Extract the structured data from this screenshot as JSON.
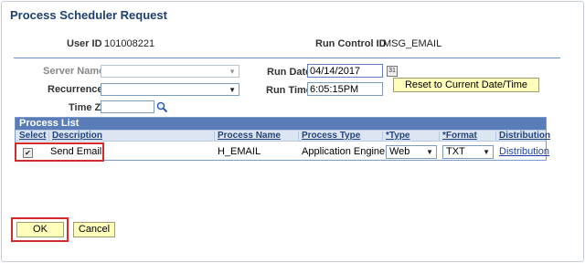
{
  "page": {
    "title": "Process Scheduler Request"
  },
  "header": {
    "user_id_label": "User ID",
    "user_id_value": "101008221",
    "run_control_label": "Run Control ID",
    "run_control_value": "MSG_EMAIL"
  },
  "form": {
    "server_name_label": "Server Name",
    "server_name_value": "",
    "recurrence_label": "Recurrence",
    "recurrence_value": "",
    "time_zone_label": "Time Zone",
    "time_zone_value": "",
    "run_date_label": "Run Date",
    "run_date_value": "04/14/2017",
    "run_time_label": "Run Time",
    "run_time_value": "6:05:15PM",
    "reset_button_label": "Reset to Current Date/Time"
  },
  "process_list": {
    "title": "Process List",
    "columns": [
      "Select",
      "Description",
      "Process Name",
      "Process Type",
      "*Type",
      "*Format",
      "Distribution"
    ],
    "rows": [
      {
        "selected": true,
        "description": "Send Email",
        "process_name": "H_EMAIL",
        "process_type": "Application Engine",
        "type": "Web",
        "format": "TXT",
        "distribution": "Distribution"
      }
    ]
  },
  "footer": {
    "ok_label": "OK",
    "cancel_label": "Cancel"
  },
  "colors": {
    "title_blue": "#1e3f6e",
    "grid_header": "#5a7db9",
    "highlight_red": "#d12b2b",
    "button_yellow": "#ffffbb"
  }
}
